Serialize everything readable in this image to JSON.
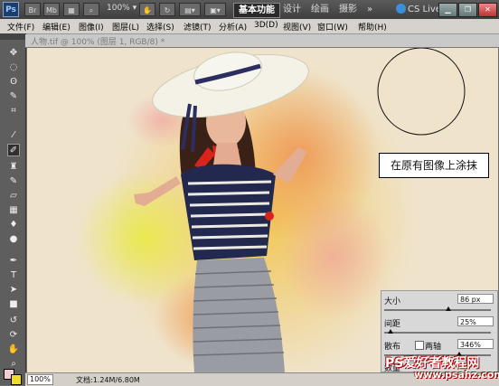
{
  "app": {
    "logo": "Ps",
    "br_label": "Br",
    "mb_label": "Mb",
    "zoom": "100%"
  },
  "workspaces": [
    "基本功能",
    "设计",
    "绘画",
    "摄影"
  ],
  "cs_live": "CS Live",
  "window_controls": [
    "minimize",
    "restore",
    "close"
  ],
  "menus": [
    "文件(F)",
    "编辑(E)",
    "图像(I)",
    "图层(L)",
    "选择(S)",
    "滤镜(T)",
    "分析(A)",
    "3D(D)",
    "视图(V)",
    "窗口(W)",
    "帮助(H)"
  ],
  "document": {
    "tab_title": "人物.tif @ 100% (图层 1, RGB/8) *"
  },
  "canvas": {
    "callout_text": "在原有图像上涂抹"
  },
  "tools": [
    "move-tool-icon",
    "marquee-tool-icon",
    "lasso-tool-icon",
    "quick-select-tool-icon",
    "crop-tool-icon",
    "eyedropper-tool-icon",
    "brush-tool-icon",
    "clone-stamp-tool-icon",
    "history-brush-tool-icon",
    "eraser-tool-icon",
    "gradient-tool-icon",
    "blur-tool-icon",
    "dodge-tool-icon",
    "pen-tool-icon",
    "type-tool-icon",
    "path-select-tool-icon",
    "shape-tool-icon",
    "3d-rotate-tool-icon",
    "3d-orbit-tool-icon",
    "hand-tool-icon",
    "zoom-tool-icon"
  ],
  "colors": {
    "foreground": "#f4cdd0",
    "background": "#f0dd2a",
    "canvas_bg": "#efe3cb",
    "active_workspace": "#2a2a2a"
  },
  "status": {
    "zoom": "100%",
    "doc": "文档:1.24M/6.80M"
  },
  "brush_panel": {
    "size_label": "大小",
    "size_value": "86 px",
    "size_level": 0.6,
    "spacing_label": "间距",
    "spacing_value": "25%",
    "spacing_level": 0.06,
    "scatter_label": "散布",
    "both_axes_label": "两轴",
    "scatter_value": "346%",
    "scatter_level": 0.7,
    "count_label": "数量"
  },
  "watermark": {
    "line1": "PS爱好者教程网",
    "line2": "www.psahz.com"
  }
}
